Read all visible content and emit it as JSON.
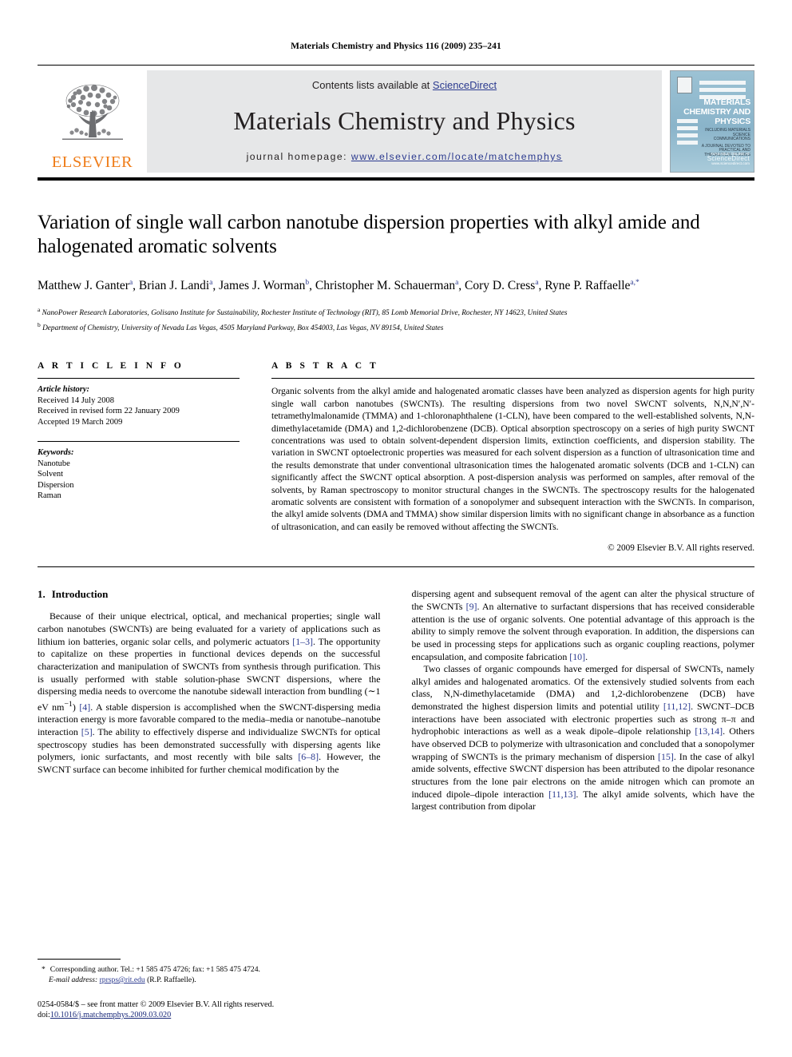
{
  "running_head": "Materials Chemistry and Physics 116 (2009) 235–241",
  "banner": {
    "publisher_name": "ELSEVIER",
    "contents_prefix": "Contents lists available at ",
    "contents_link": "ScienceDirect",
    "journal_name": "Materials Chemistry and Physics",
    "homepage_prefix": "journal homepage: ",
    "homepage_url": "www.elsevier.com/locate/matchemphys",
    "cover": {
      "title_line1": "MATERIALS",
      "title_line2": "CHEMISTRY AND",
      "title_line3": "PHYSICS",
      "sub": "INCLUDING MATERIALS SCIENCE COMMUNICATIONS",
      "sub2": "A JOURNAL DEVOTED TO PRACTICAL AND THEORETICAL STUDIES",
      "footer_small": "AVAILABLE ONLINE AT",
      "footer_big": "ScienceDirect",
      "footer_tiny": "www.sciencedirect.com"
    }
  },
  "article": {
    "title": "Variation of single wall carbon nanotube dispersion properties with alkyl amide and halogenated aromatic solvents",
    "authors_html": "Matthew J. Ganter<sup>a</sup>, Brian J. Landi<sup>a</sup>, James J. Worman<sup>b</sup>, Christopher M. Schauerman<sup>a</sup>, Cory D. Cress<sup>a</sup>, Ryne P. Raffaelle<sup>a,*</sup>",
    "affiliation_a": "NanoPower Research Laboratories, Golisano Institute for Sustainability, Rochester Institute of Technology (RIT), 85 Lomb Memorial Drive, Rochester, NY 14623, United States",
    "affiliation_b": "Department of Chemistry, University of Nevada Las Vegas, 4505 Maryland Parkway, Box 454003, Las Vegas, NV 89154, United States"
  },
  "article_info": {
    "heading": "A R T I C L E   I N F O",
    "history_label": "Article history:",
    "history": [
      "Received 14 July 2008",
      "Received in revised form 22 January 2009",
      "Accepted 19 March 2009"
    ],
    "keywords_label": "Keywords:",
    "keywords": [
      "Nanotube",
      "Solvent",
      "Dispersion",
      "Raman"
    ]
  },
  "abstract": {
    "heading": "A B S T R A C T",
    "text": "Organic solvents from the alkyl amide and halogenated aromatic classes have been analyzed as dispersion agents for high purity single wall carbon nanotubes (SWCNTs). The resulting dispersions from two novel SWCNT solvents, N,N,N′,N′-tetramethylmalonamide (TMMA) and 1-chloronaphthalene (1-CLN), have been compared to the well-established solvents, N,N-dimethylacetamide (DMA) and 1,2-dichlorobenzene (DCB). Optical absorption spectroscopy on a series of high purity SWCNT concentrations was used to obtain solvent-dependent dispersion limits, extinction coefficients, and dispersion stability. The variation in SWCNT optoelectronic properties was measured for each solvent dispersion as a function of ultrasonication time and the results demonstrate that under conventional ultrasonication times the halogenated aromatic solvents (DCB and 1-CLN) can significantly affect the SWCNT optical absorption. A post-dispersion analysis was performed on samples, after removal of the solvents, by Raman spectroscopy to monitor structural changes in the SWCNTs. The spectroscopy results for the halogenated aromatic solvents are consistent with formation of a sonopolymer and subsequent interaction with the SWCNTs. In comparison, the alkyl amide solvents (DMA and TMMA) show similar dispersion limits with no significant change in absorbance as a function of ultrasonication, and can easily be removed without affecting the SWCNTs.",
    "copyright": "© 2009 Elsevier B.V. All rights reserved."
  },
  "body": {
    "section_number": "1.",
    "section_title": "Introduction",
    "left_para_1_html": "Because of their unique electrical, optical, and mechanical properties; single wall carbon nanotubes (SWCNTs) are being evaluated for a variety of applications such as lithium ion batteries, organic solar cells, and polymeric actuators <span class=\"ref\">[1–3]</span>. The opportunity to capitalize on these properties in functional devices depends on the successful characterization and manipulation of SWCNTs from synthesis through purification. This is usually performed with stable solution-phase SWCNT dispersions, where the dispersing media needs to overcome the nanotube sidewall interaction from bundling (∼1 eV nm<sup>−1</sup>) <span class=\"ref\">[4]</span>. A stable dispersion is accomplished when the SWCNT-dispersing media interaction energy is more favorable compared to the media–media or nanotube–nanotube interaction <span class=\"ref\">[5]</span>. The ability to effectively disperse and individualize SWCNTs for optical spectroscopy studies has been demonstrated successfully with dispersing agents like polymers, ionic surfactants, and most recently with bile salts <span class=\"ref\">[6–8]</span>. However, the SWCNT surface can become inhibited for further chemical modification by the",
    "right_para_1_html": "dispersing agent and subsequent removal of the agent can alter the physical structure of the SWCNTs <span class=\"ref\">[9]</span>. An alternative to surfactant dispersions that has received considerable attention is the use of organic solvents. One potential advantage of this approach is the ability to simply remove the solvent through evaporation. In addition, the dispersions can be used in processing steps for applications such as organic coupling reactions, polymer encapsulation, and composite fabrication <span class=\"ref\">[10]</span>.",
    "right_para_2_html": "Two classes of organic compounds have emerged for dispersal of SWCNTs, namely alkyl amides and halogenated aromatics. Of the extensively studied solvents from each class, N,N-dimethylacetamide (DMA) and 1,2-dichlorobenzene (DCB) have demonstrated the highest dispersion limits and potential utility <span class=\"ref\">[11,12]</span>. SWCNT–DCB interactions have been associated with electronic properties such as strong π–π and hydrophobic interactions as well as a weak dipole–dipole relationship <span class=\"ref\">[13,14]</span>. Others have observed DCB to polymerize with ultrasonication and concluded that a sonopolymer wrapping of SWCNTs is the primary mechanism of dispersion <span class=\"ref\">[15]</span>. In the case of alkyl amide solvents, effective SWCNT dispersion has been attributed to the dipolar resonance structures from the lone pair electrons on the amide nitrogen which can promote an induced dipole–dipole interaction <span class=\"ref\">[11,13]</span>. The alkyl amide solvents, which have the largest contribution from dipolar"
  },
  "footer": {
    "corresponding_star": "*",
    "corresponding_text": "Corresponding author. Tel.: +1 585 475 4726; fax: +1 585 475 4724.",
    "email_label": "E-mail address:",
    "email": "rprsps@rit.edu",
    "email_owner": "(R.P. Raffaelle).",
    "issn_line": "0254-0584/$ – see front matter © 2009 Elsevier B.V. All rights reserved.",
    "doi_label": "doi:",
    "doi": "10.1016/j.matchemphys.2009.03.020"
  },
  "colors": {
    "link": "#2b3a8f",
    "elsevier_orange": "#ef7d1a",
    "banner_gray": "#e6e7e8",
    "cover_blue": "#8fb8cc"
  }
}
